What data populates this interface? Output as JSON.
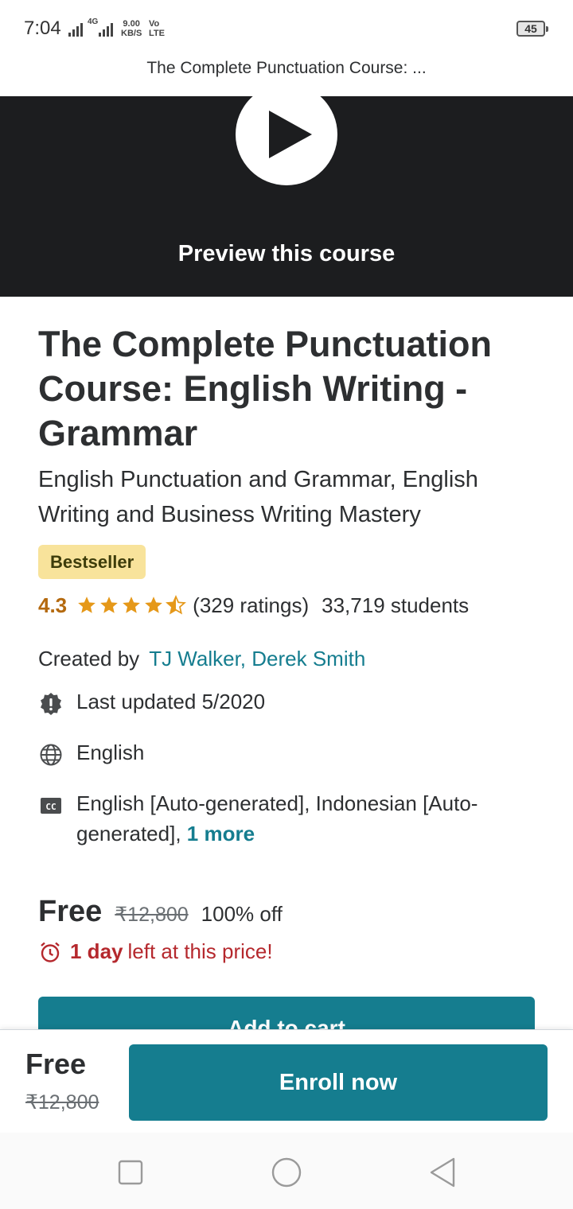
{
  "status_bar": {
    "time": "7:04",
    "network": "4G",
    "speed_value": "9.00",
    "speed_unit": "KB/S",
    "volte_top": "Vo",
    "volte_bottom": "LTE",
    "battery": "45"
  },
  "page_header": {
    "title": "The Complete Punctuation Course: ..."
  },
  "preview": {
    "label": "Preview this course"
  },
  "course": {
    "title": "The Complete Punctuation Course: English Writing - Grammar",
    "subtitle": "English Punctuation and Grammar, English Writing and Business Writing Mastery",
    "badge": "Bestseller",
    "rating": "4.3",
    "rating_stars": 4.3,
    "ratings_count": "(329 ratings)",
    "students": "33,719 students",
    "created_by_label": "Created by",
    "authors": "TJ Walker, Derek Smith",
    "last_updated": "Last updated 5/2020",
    "language": "English",
    "captions": "English [Auto-generated], Indonesian [Auto-generated],",
    "captions_more": "1 more"
  },
  "pricing": {
    "price": "Free",
    "original_price": "₹12,800",
    "discount": "100% off",
    "deadline_bold": "1 day",
    "deadline_rest": "left at this price!",
    "add_to_cart": "Add to cart"
  },
  "bottom_bar": {
    "price": "Free",
    "original_price": "₹12,800",
    "enroll_label": "Enroll now"
  },
  "colors": {
    "accent": "#157d8f",
    "rating": "#b4690e",
    "badge_bg": "#f8e39b",
    "deadline": "#b5282d",
    "preview_bg": "#1c1d1f"
  },
  "icons": {
    "updated": "alert-badge-icon",
    "language": "globe-icon",
    "captions": "closed-captions-icon",
    "deadline": "alarm-clock-icon",
    "play": "play-icon"
  }
}
